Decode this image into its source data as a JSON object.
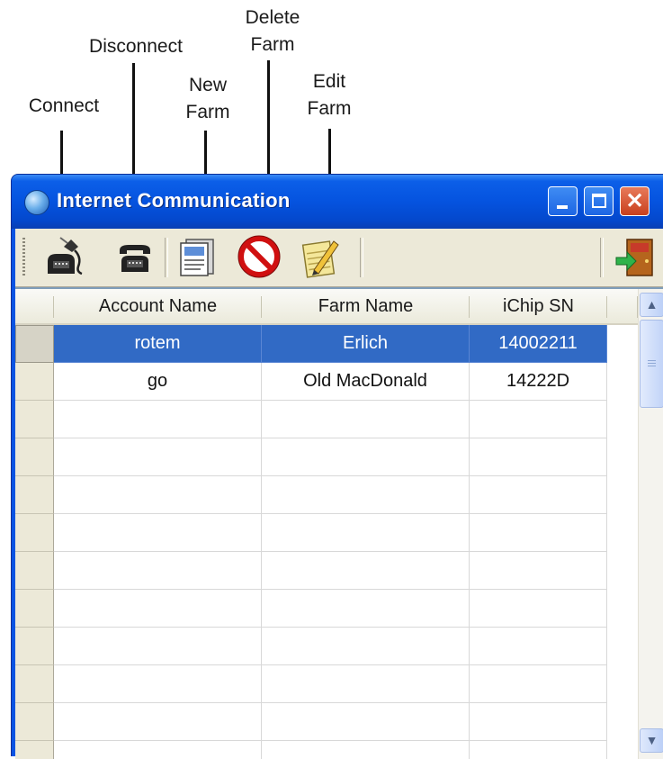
{
  "callouts": {
    "connect": "Connect",
    "disconnect": "Disconnect",
    "new_farm": "New\nFarm",
    "delete_farm": "Delete\nFarm",
    "edit_farm": "Edit\nFarm"
  },
  "window": {
    "title": "Internet Communication",
    "close_glyph": "✕"
  },
  "toolbar": {
    "tools": [
      "connect-phone-icon",
      "disconnect-phone-icon",
      "new-farm-document-icon",
      "delete-farm-no-sign-icon",
      "edit-farm-notepad-icon",
      "exit-door-icon"
    ]
  },
  "table": {
    "columns": [
      "Account Name",
      "Farm Name",
      "iChip SN"
    ],
    "rows": [
      {
        "account": "rotem",
        "farm": "Erlich",
        "sn": "14002211",
        "selected": true
      },
      {
        "account": "go",
        "farm": "Old MacDonald",
        "sn": "14222D",
        "selected": false
      }
    ]
  },
  "scrollbar": {
    "up_glyph": "▲",
    "down_glyph": "▼"
  }
}
